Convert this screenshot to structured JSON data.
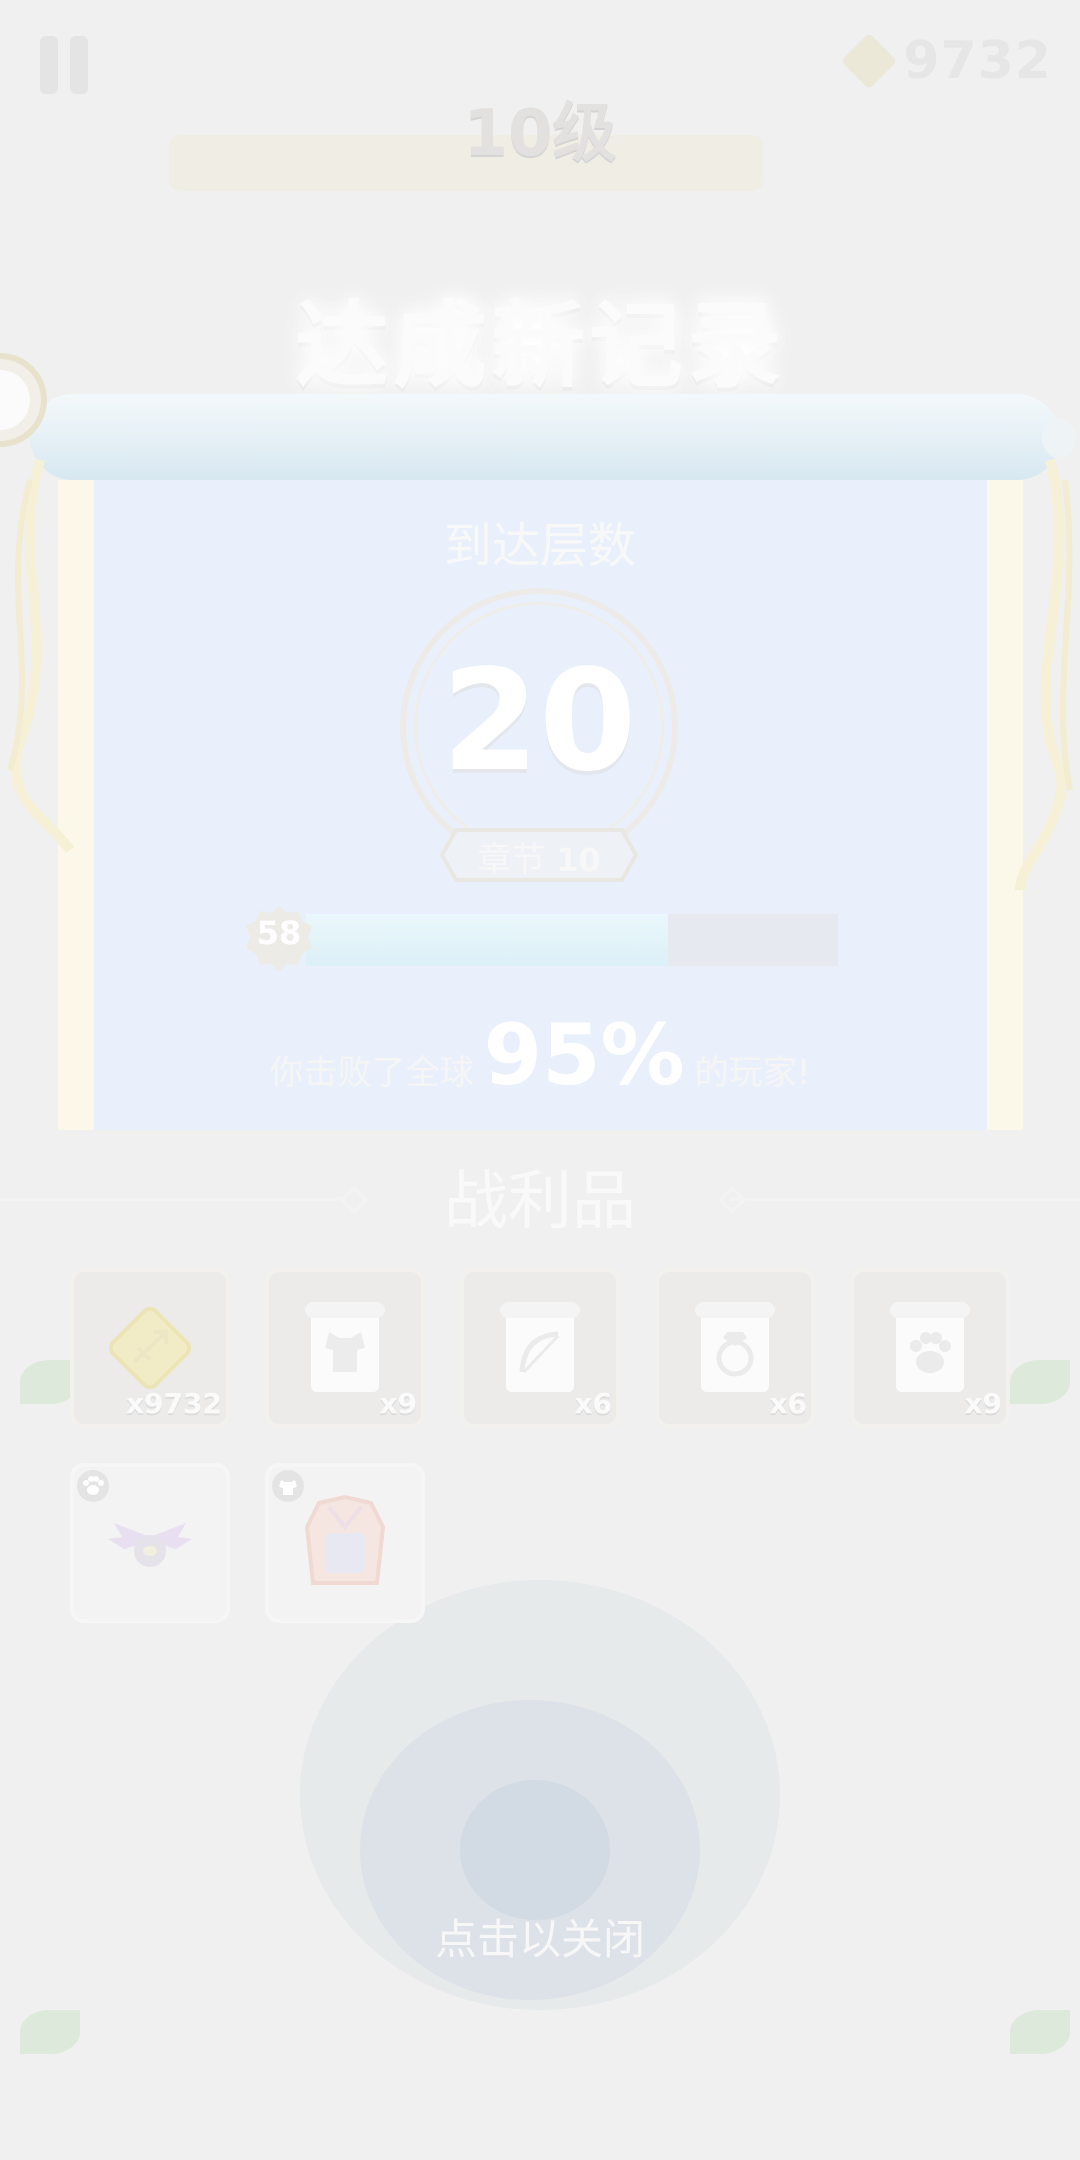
{
  "hud": {
    "gem_count": "9732",
    "level_label": "10级"
  },
  "result": {
    "title": "达成新记录",
    "reached_label": "到达层数",
    "floor": "20",
    "chapter_label": "章节",
    "chapter_number": "10",
    "xp_level": "58",
    "xp_progress": 0.68,
    "defeat_prefix": "你击败了全球",
    "defeat_percent": "95%",
    "defeat_suffix": "的玩家!"
  },
  "loot": {
    "title": "战利品",
    "items": [
      {
        "icon": "gem-icon",
        "qty": "x9732"
      },
      {
        "icon": "armor-scroll-icon",
        "qty": "x9"
      },
      {
        "icon": "bow-scroll-icon",
        "qty": "x6"
      },
      {
        "icon": "ring-scroll-icon",
        "qty": "x6"
      },
      {
        "icon": "paw-scroll-icon",
        "qty": "x9"
      },
      {
        "icon": "bat-pet-icon",
        "qty": ""
      },
      {
        "icon": "cloak-armor-icon",
        "qty": ""
      }
    ]
  },
  "close_hint": "点击以关闭"
}
